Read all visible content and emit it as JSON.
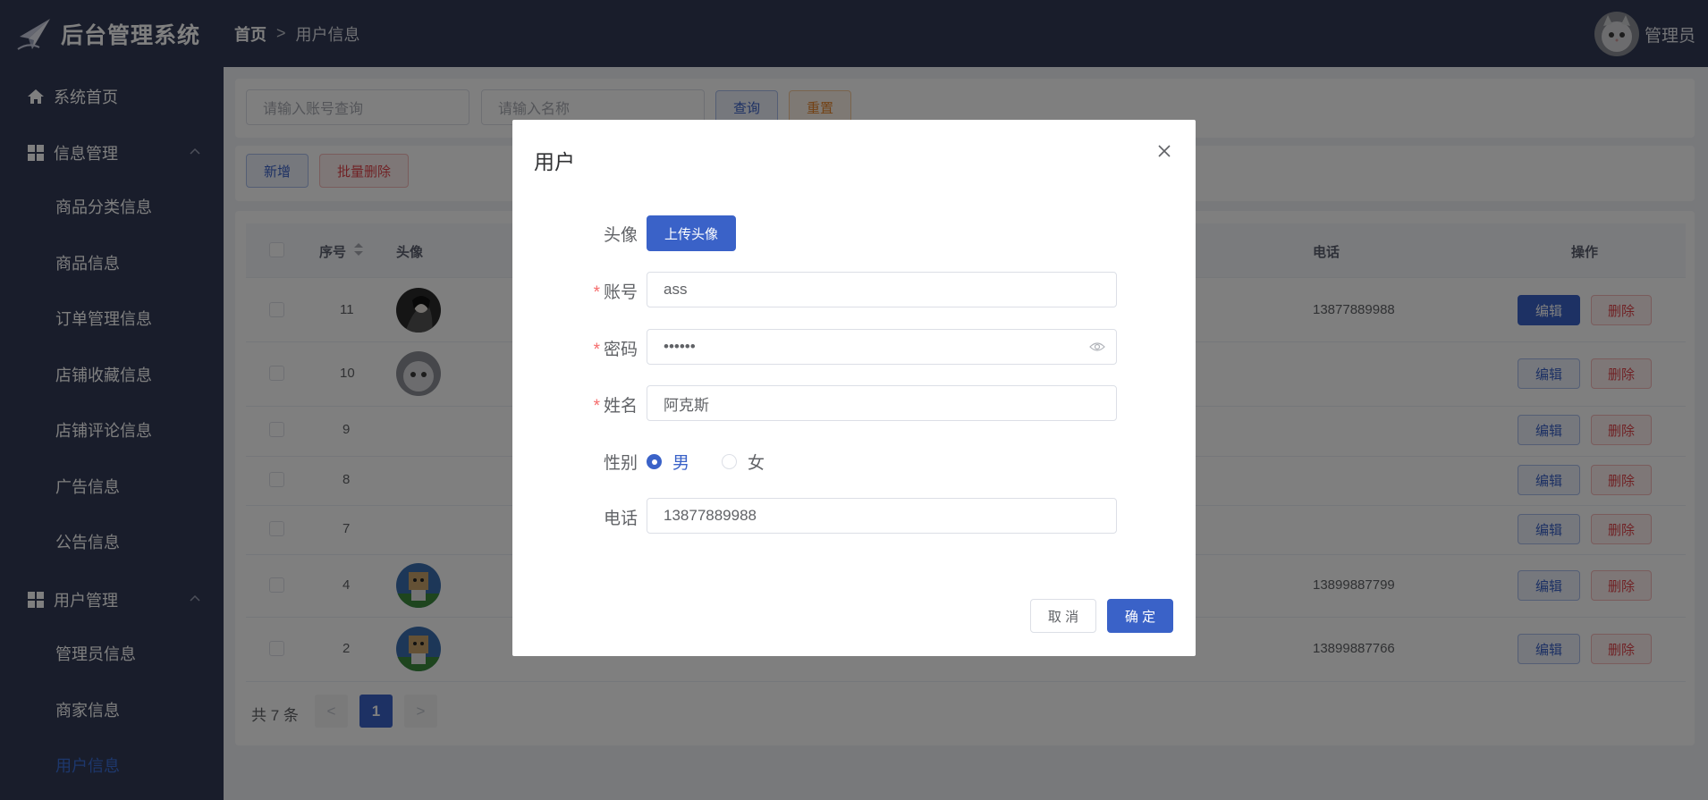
{
  "header": {
    "logo_text": "后台管理系统",
    "breadcrumb_home": "首页",
    "breadcrumb_sep": ">",
    "breadcrumb_current": "用户信息",
    "user_name": "管理员"
  },
  "sidebar": {
    "home": "系统首页",
    "info_group": "信息管理",
    "info_items": [
      "商品分类信息",
      "商品信息",
      "订单管理信息",
      "店铺收藏信息",
      "店铺评论信息",
      "广告信息",
      "公告信息"
    ],
    "user_group": "用户管理",
    "user_items": [
      "管理员信息",
      "商家信息",
      "用户信息"
    ],
    "active_item": "用户信息"
  },
  "search": {
    "account_placeholder": "请输入账号查询",
    "name_placeholder": "请输入名称",
    "query_label": "查询",
    "reset_label": "重置"
  },
  "toolbar": {
    "add_label": "新增",
    "batch_delete_label": "批量删除"
  },
  "table": {
    "headers": {
      "index": "序号",
      "avatar": "头像",
      "phone": "电话",
      "actions": "操作"
    },
    "rows": [
      {
        "index": "11",
        "phone": "13877889988"
      },
      {
        "index": "10",
        "phone": ""
      },
      {
        "index": "9",
        "phone": ""
      },
      {
        "index": "8",
        "phone": ""
      },
      {
        "index": "7",
        "phone": ""
      },
      {
        "index": "4",
        "phone": "13899887799"
      },
      {
        "index": "2",
        "phone": "13899887766"
      }
    ],
    "edit_label": "编辑",
    "delete_label": "删除"
  },
  "pagination": {
    "total_text": "共 7 条",
    "current_page": "1",
    "prev": "<",
    "next": ">"
  },
  "dialog": {
    "title": "用户",
    "avatar_label": "头像",
    "upload_label": "上传头像",
    "account_label": "账号",
    "account_value": "ass",
    "password_label": "密码",
    "password_value": "••••••",
    "name_label": "姓名",
    "name_value": "阿克斯",
    "gender_label": "性别",
    "gender_male": "男",
    "gender_female": "女",
    "gender_selected": "男",
    "phone_label": "电话",
    "phone_value": "13877889988",
    "required_mark": "*",
    "cancel_label": "取 消",
    "confirm_label": "确 定"
  },
  "colors": {
    "sidebar_bg": "#333b56",
    "primary": "#3a62c8",
    "danger": "#e0454b",
    "warning": "#e6842b",
    "overlay": "rgba(0,0,0,0.5)"
  }
}
